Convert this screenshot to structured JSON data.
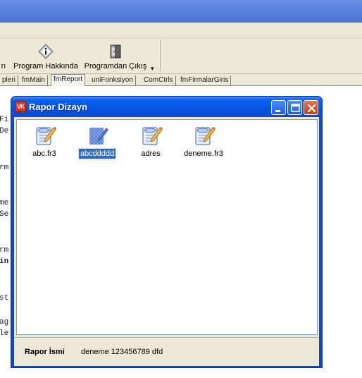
{
  "toolbar": {
    "items": [
      {
        "label": "rı"
      },
      {
        "label": "Program Hakkında"
      },
      {
        "label": "Programdan Çıkış"
      }
    ]
  },
  "tabs": [
    {
      "label": "pleri"
    },
    {
      "label": "fmMain"
    },
    {
      "label": "fmReport"
    },
    {
      "label": "uniFonksiyon"
    },
    {
      "label": "ComCtrls"
    },
    {
      "label": "fmFirmalarGiris"
    }
  ],
  "code_fragments": [
    "Fi",
    "De",
    "rm",
    "me",
    "Se",
    "rm",
    "in",
    "st",
    "ag",
    "le"
  ],
  "dialog": {
    "title": "Rapor Dizayn",
    "files": [
      {
        "name": "abc.fr3",
        "icon": "report-edit-icon",
        "selected": false
      },
      {
        "name": "abcddddd",
        "icon": "report-blank-icon",
        "selected": true
      },
      {
        "name": "adres",
        "icon": "report-edit-icon",
        "selected": false
      },
      {
        "name": "deneme.fr3",
        "icon": "report-edit-icon",
        "selected": false
      }
    ],
    "status": {
      "label": "Rapor İsmi",
      "value": "deneme 123456789 dfd"
    }
  },
  "colors": {
    "titlebar": "#0654e2",
    "selection": "#316ac5",
    "window_bg": "#ece9d8"
  }
}
